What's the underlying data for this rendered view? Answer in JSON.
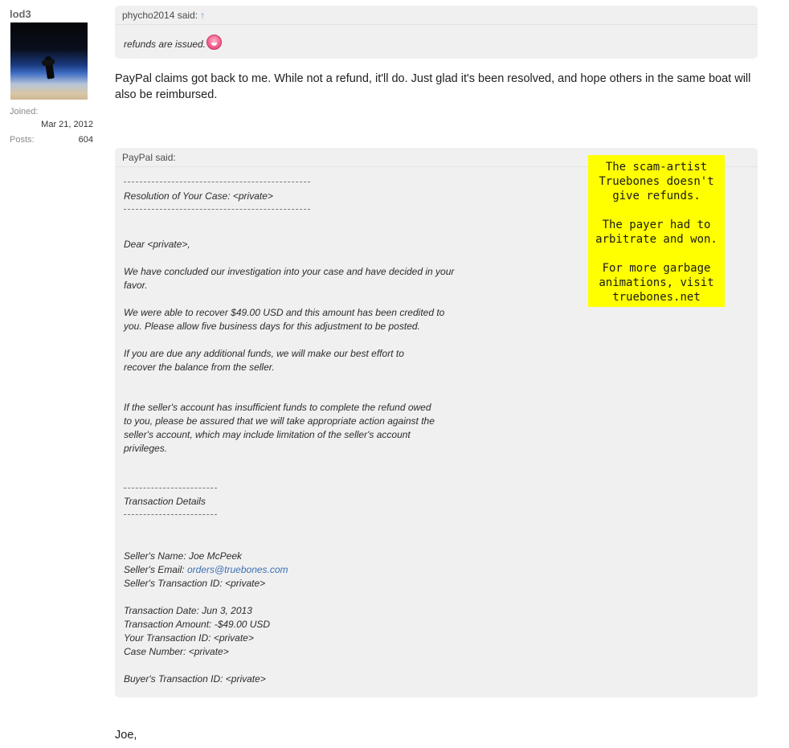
{
  "user": {
    "name": "lod3",
    "joined_label": "Joined:",
    "joined_value": "Mar 21, 2012",
    "posts_label": "Posts:",
    "posts_value": "604"
  },
  "quote1": {
    "author_said": "phycho2014 said:",
    "arrow": "↑",
    "text": "refunds are issued."
  },
  "post_text": "PayPal claims got back to me. While not a refund, it'll do. Just glad it's been resolved, and hope others in the same boat will also be reimbursed.",
  "quote2": {
    "author_said": "PayPal said:",
    "resolution": "Resolution of Your Case: <private>",
    "dear": "Dear <private>,",
    "para1": [
      "We have concluded our investigation into your case and have decided in your",
      "favor."
    ],
    "para2": [
      "We were able to recover $49.00 USD and this amount has been credited to",
      "you. Please allow five business days for this adjustment to be posted."
    ],
    "para3": [
      "If you are due any additional funds, we will make our best effort to",
      "recover the balance from the seller."
    ],
    "para4": [
      "If the seller's account has insufficient funds to complete the refund owed",
      "to you, please be assured that we will take appropriate action against the",
      "seller's account, which may include limitation of the seller's account",
      "privileges."
    ],
    "transaction_details": "Transaction Details",
    "seller_name": "Seller's Name: Joe McPeek",
    "seller_email_label": "Seller's Email: ",
    "seller_email": "orders@truebones.com",
    "seller_txn": "Seller's Transaction ID: <private>",
    "txn_date": "Transaction Date: Jun 3, 2013",
    "txn_amount": "Transaction Amount: -$49.00 USD",
    "your_txn": "Your Transaction ID: <private>",
    "case_number": "Case Number: <private>",
    "buyer_txn": "Buyer's Transaction ID: <private>"
  },
  "sticker": {
    "lines1": [
      "The scam-artist",
      "Truebones doesn't",
      "give refunds."
    ],
    "lines2": [
      "The payer had to",
      "arbitrate and won."
    ],
    "lines3": [
      "For more garbage",
      "animations, visit",
      "truebones.net"
    ]
  },
  "signoff": "Joe,",
  "colors": {
    "sticker": "#ffff00",
    "link": "#3a6fb5",
    "quote_bg": "#f0f0f0"
  }
}
